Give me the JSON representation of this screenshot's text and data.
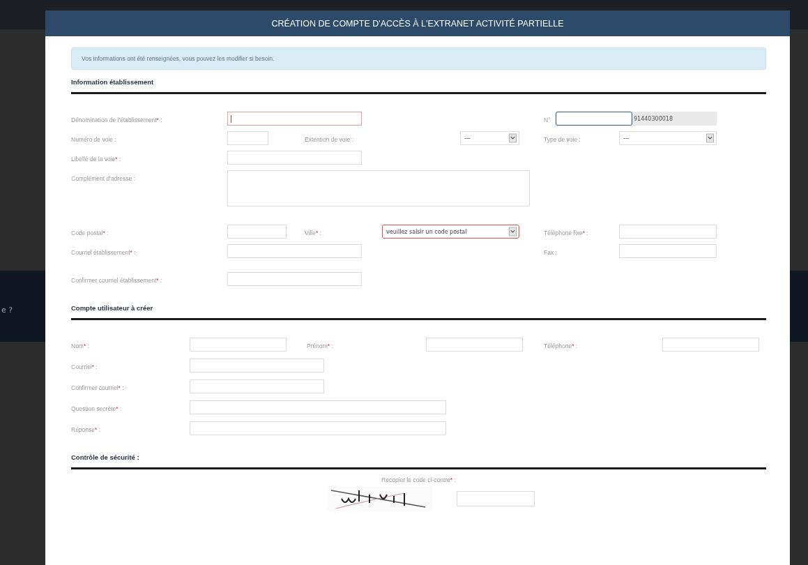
{
  "background": {
    "side_text": "e ?"
  },
  "dialog": {
    "title": "CRÉATION DE COMPTE D'ACCÈS À L'EXTRANET ACTIVITÉ PARTIELLE",
    "info": "Vos informations ont été renseignées, vous pouvez les modifier si besoin.",
    "sections": [
      {
        "title": "Information établissement",
        "rows": [
          [
            {
              "label": "Dénomination de l'établissement",
              "mark": "*",
              "after": " :",
              "kind": "text",
              "error": true,
              "focused": false,
              "caret": true
            },
            {
              "label": "N°",
              "kind": "siret",
              "focused": true,
              "value": "91440300018"
            }
          ],
          [
            {
              "label": "Numéro de voie :",
              "kind": "text",
              "error": false,
              "focused": false
            },
            {
              "label": "Extention de voie :",
              "kind": "select",
              "value": "---",
              "error": false
            },
            {
              "label": "Type de voie :",
              "kind": "select",
              "value": "---",
              "error": false
            }
          ],
          [
            {
              "label": "Libellé de la voie",
              "mark": "*",
              "after": " :",
              "kind": "text",
              "error": false,
              "focused": false
            }
          ],
          [
            {
              "label": "Complément d'adresse :",
              "kind": "textarea"
            }
          ],
          [
            {
              "label": "Code postal",
              "mark": "*",
              "after": " :",
              "kind": "text",
              "error": false,
              "focused": false
            },
            {
              "label": "Ville",
              "mark": "*",
              "after": " :",
              "kind": "select",
              "value": "veuillez saisir un code postal",
              "error": true
            },
            {
              "label": "Téléphone fixe",
              "mark": "*",
              "after": " :",
              "kind": "text",
              "error": false,
              "focused": false
            }
          ],
          [
            {
              "label": "Courriel établissement",
              "mark": "*",
              "after": " :",
              "kind": "text",
              "error": false,
              "focused": false
            },
            {
              "label": "Fax :",
              "kind": "text",
              "error": false,
              "focused": false
            }
          ],
          [
            {
              "label": "Confirmer courriel établissement",
              "mark": "*",
              "after": " :",
              "kind": "text",
              "error": false,
              "focused": false
            }
          ]
        ]
      },
      {
        "title": "Compte utilisateur à créer",
        "rows": [
          [
            {
              "label": "Nom",
              "mark": "*",
              "after": " :",
              "kind": "text",
              "error": false,
              "focused": false
            },
            {
              "label": "Prénom",
              "mark": "*",
              "after": " :",
              "kind": "text",
              "error": false,
              "focused": false
            },
            {
              "label": "Téléphone",
              "mark": "*",
              "after": " :",
              "kind": "text",
              "error": false,
              "focused": false
            }
          ],
          [
            {
              "label": "Courriel",
              "mark": "*",
              "after": " :",
              "kind": "text",
              "error": false,
              "focused": false
            }
          ],
          [
            {
              "label": "Confirmer courriel",
              "mark": "*",
              "after": " :",
              "kind": "text",
              "error": false,
              "focused": false
            }
          ],
          [
            {
              "label": "Question secrète",
              "mark": "*",
              "after": " :",
              "kind": "text",
              "error": false,
              "focused": false
            }
          ],
          [
            {
              "label": "Réponse",
              "mark": "*",
              "after": " :",
              "kind": "text",
              "error": false,
              "focused": false
            }
          ]
        ]
      },
      {
        "title": "Contrôle de sécurité :",
        "captcha": {
          "label": "Recopier le code ci-contre",
          "mark": "*",
          "after": " :"
        }
      }
    ]
  }
}
